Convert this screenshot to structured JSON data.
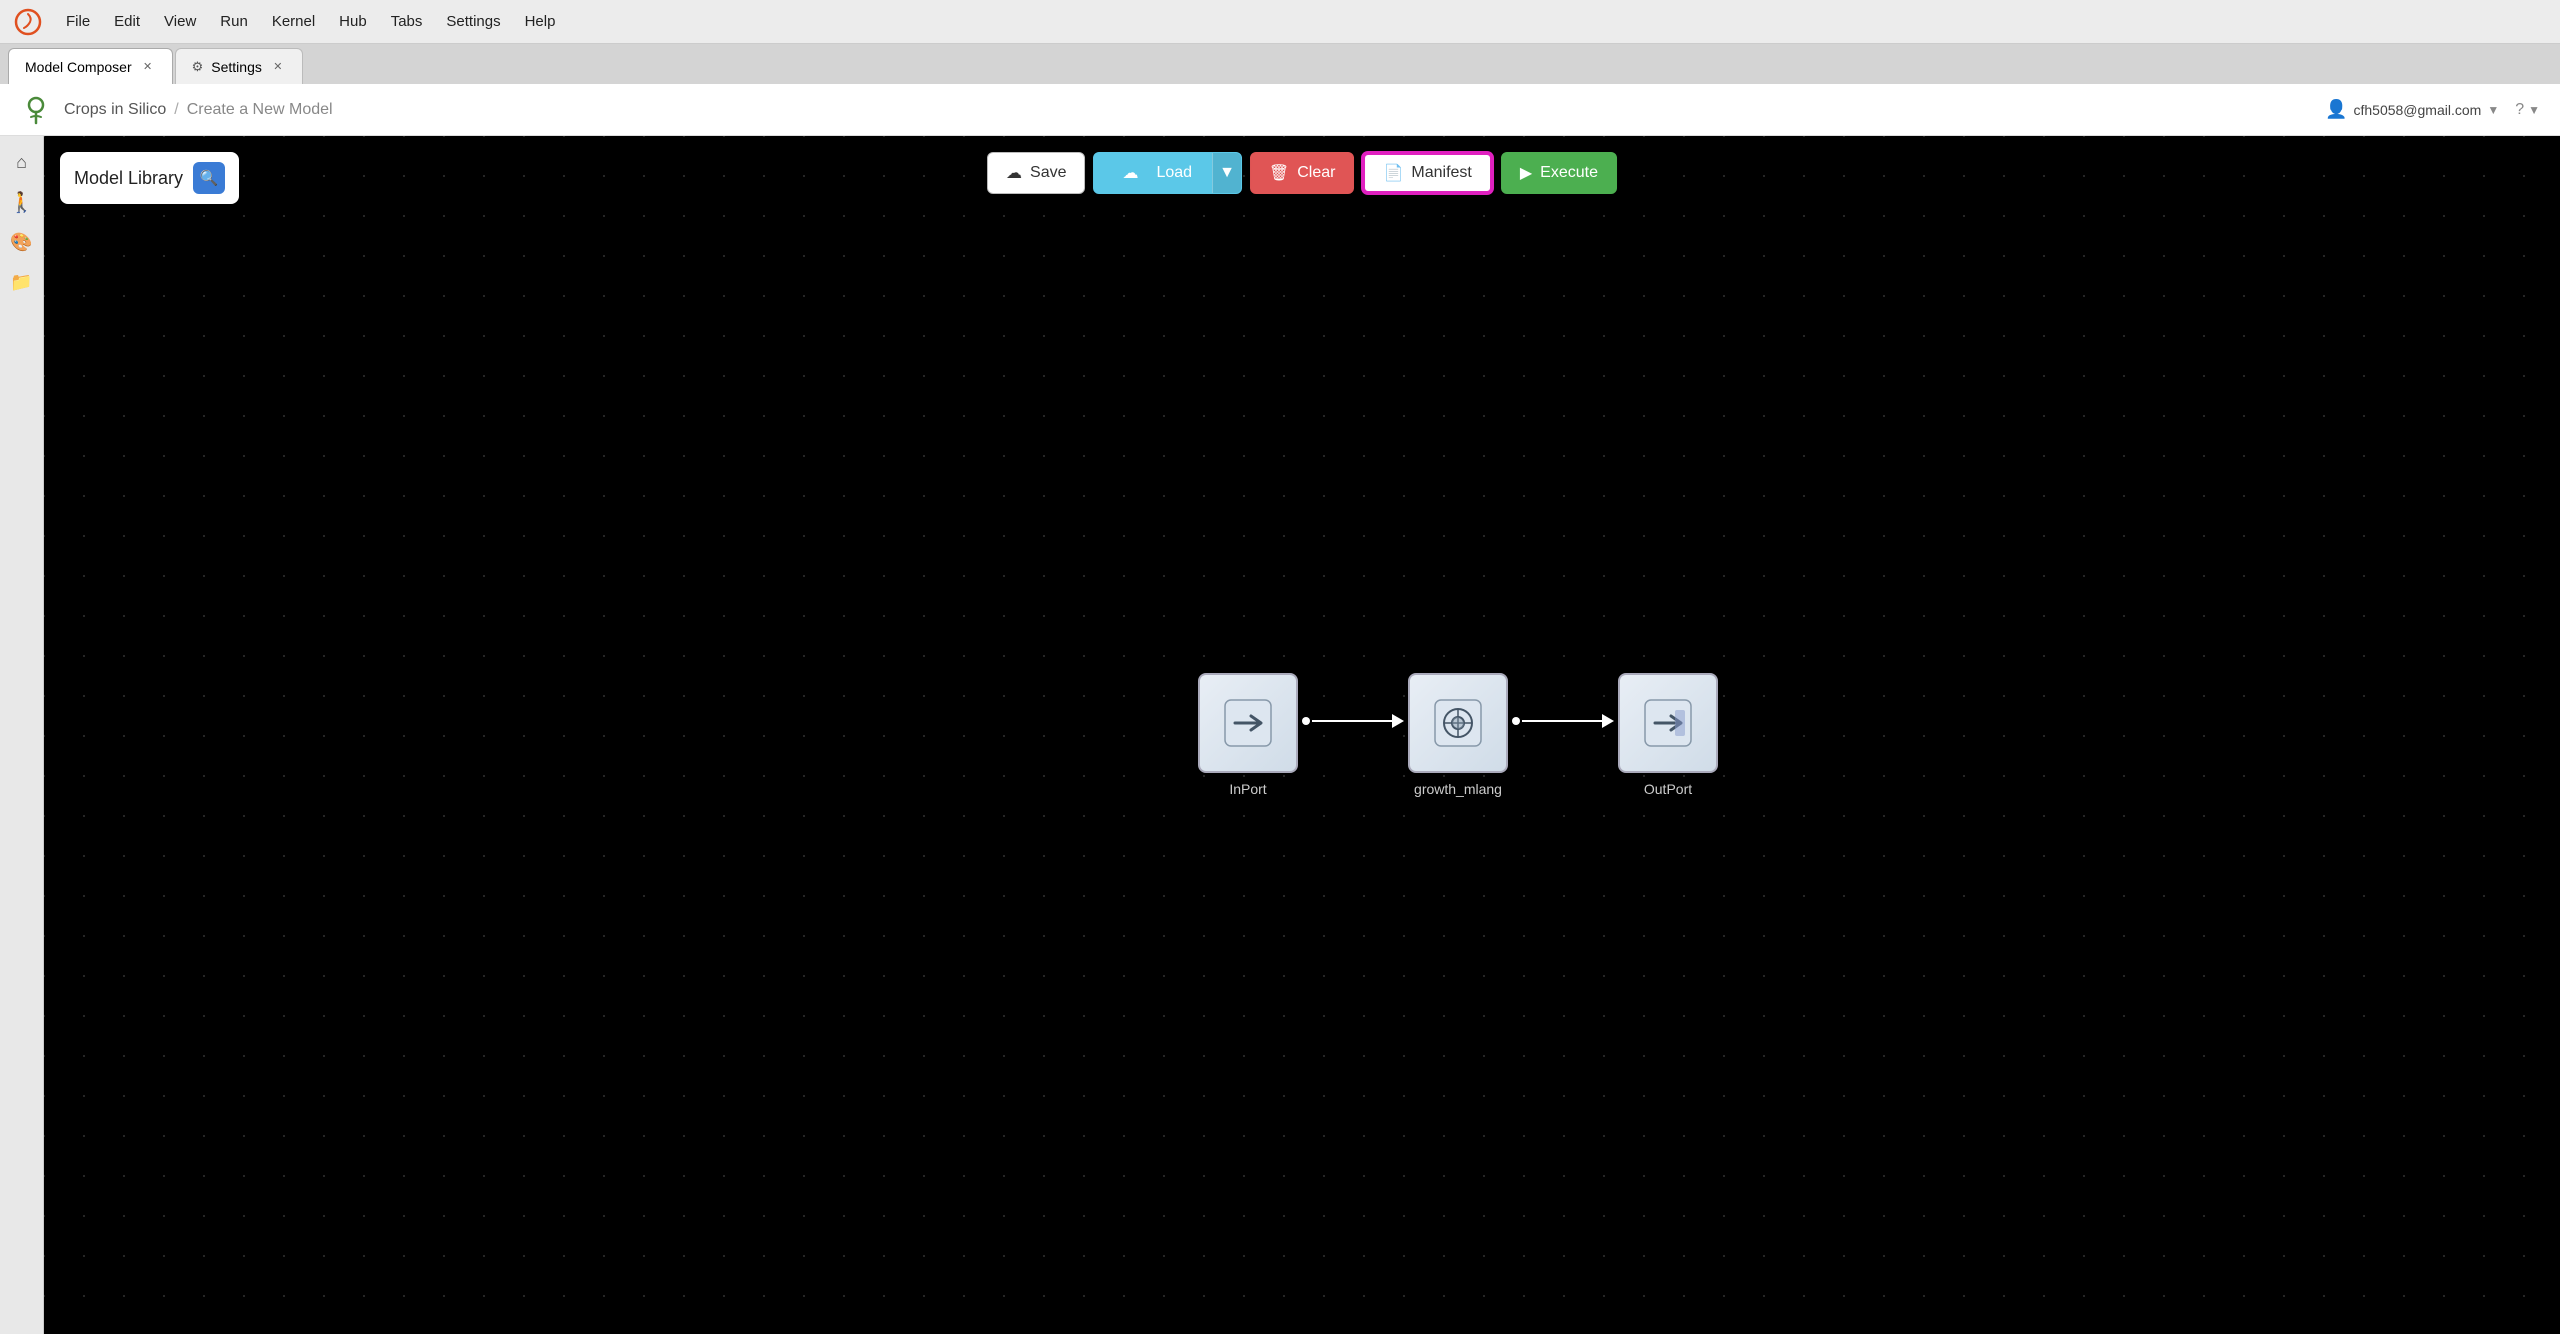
{
  "menubar": {
    "items": [
      "File",
      "Edit",
      "View",
      "Run",
      "Kernel",
      "Hub",
      "Tabs",
      "Settings",
      "Help"
    ]
  },
  "tabs": [
    {
      "id": "model-composer",
      "label": "Model Composer",
      "active": true,
      "icon": ""
    },
    {
      "id": "settings",
      "label": "Settings",
      "active": false,
      "icon": "⚙"
    }
  ],
  "navbar": {
    "breadcrumb_root": "Crops in Silico",
    "breadcrumb_current": "Create a New Model",
    "user_email": "cfh5058@gmail.com",
    "help_label": "?"
  },
  "sidebar": {
    "icons": [
      {
        "id": "home",
        "symbol": "⌂"
      },
      {
        "id": "run",
        "symbol": "🚶"
      },
      {
        "id": "brush",
        "symbol": "🎨"
      },
      {
        "id": "folder",
        "symbol": "📁"
      }
    ]
  },
  "model_library": {
    "label": "Model Library",
    "search_icon": "🔍"
  },
  "toolbar": {
    "save_label": "Save",
    "load_label": "Load",
    "clear_label": "Clear",
    "manifest_label": "Manifest",
    "execute_label": "Execute",
    "save_icon": "☁",
    "load_icon": "☁",
    "clear_icon": "🗑",
    "manifest_icon": "📄",
    "execute_icon": "▶"
  },
  "flow": {
    "nodes": [
      {
        "id": "inport",
        "label": "InPort",
        "icon": "→"
      },
      {
        "id": "growth_mlang",
        "label": "growth_mlang",
        "icon": "⚙"
      },
      {
        "id": "outport",
        "label": "OutPort",
        "icon": "→"
      }
    ]
  }
}
